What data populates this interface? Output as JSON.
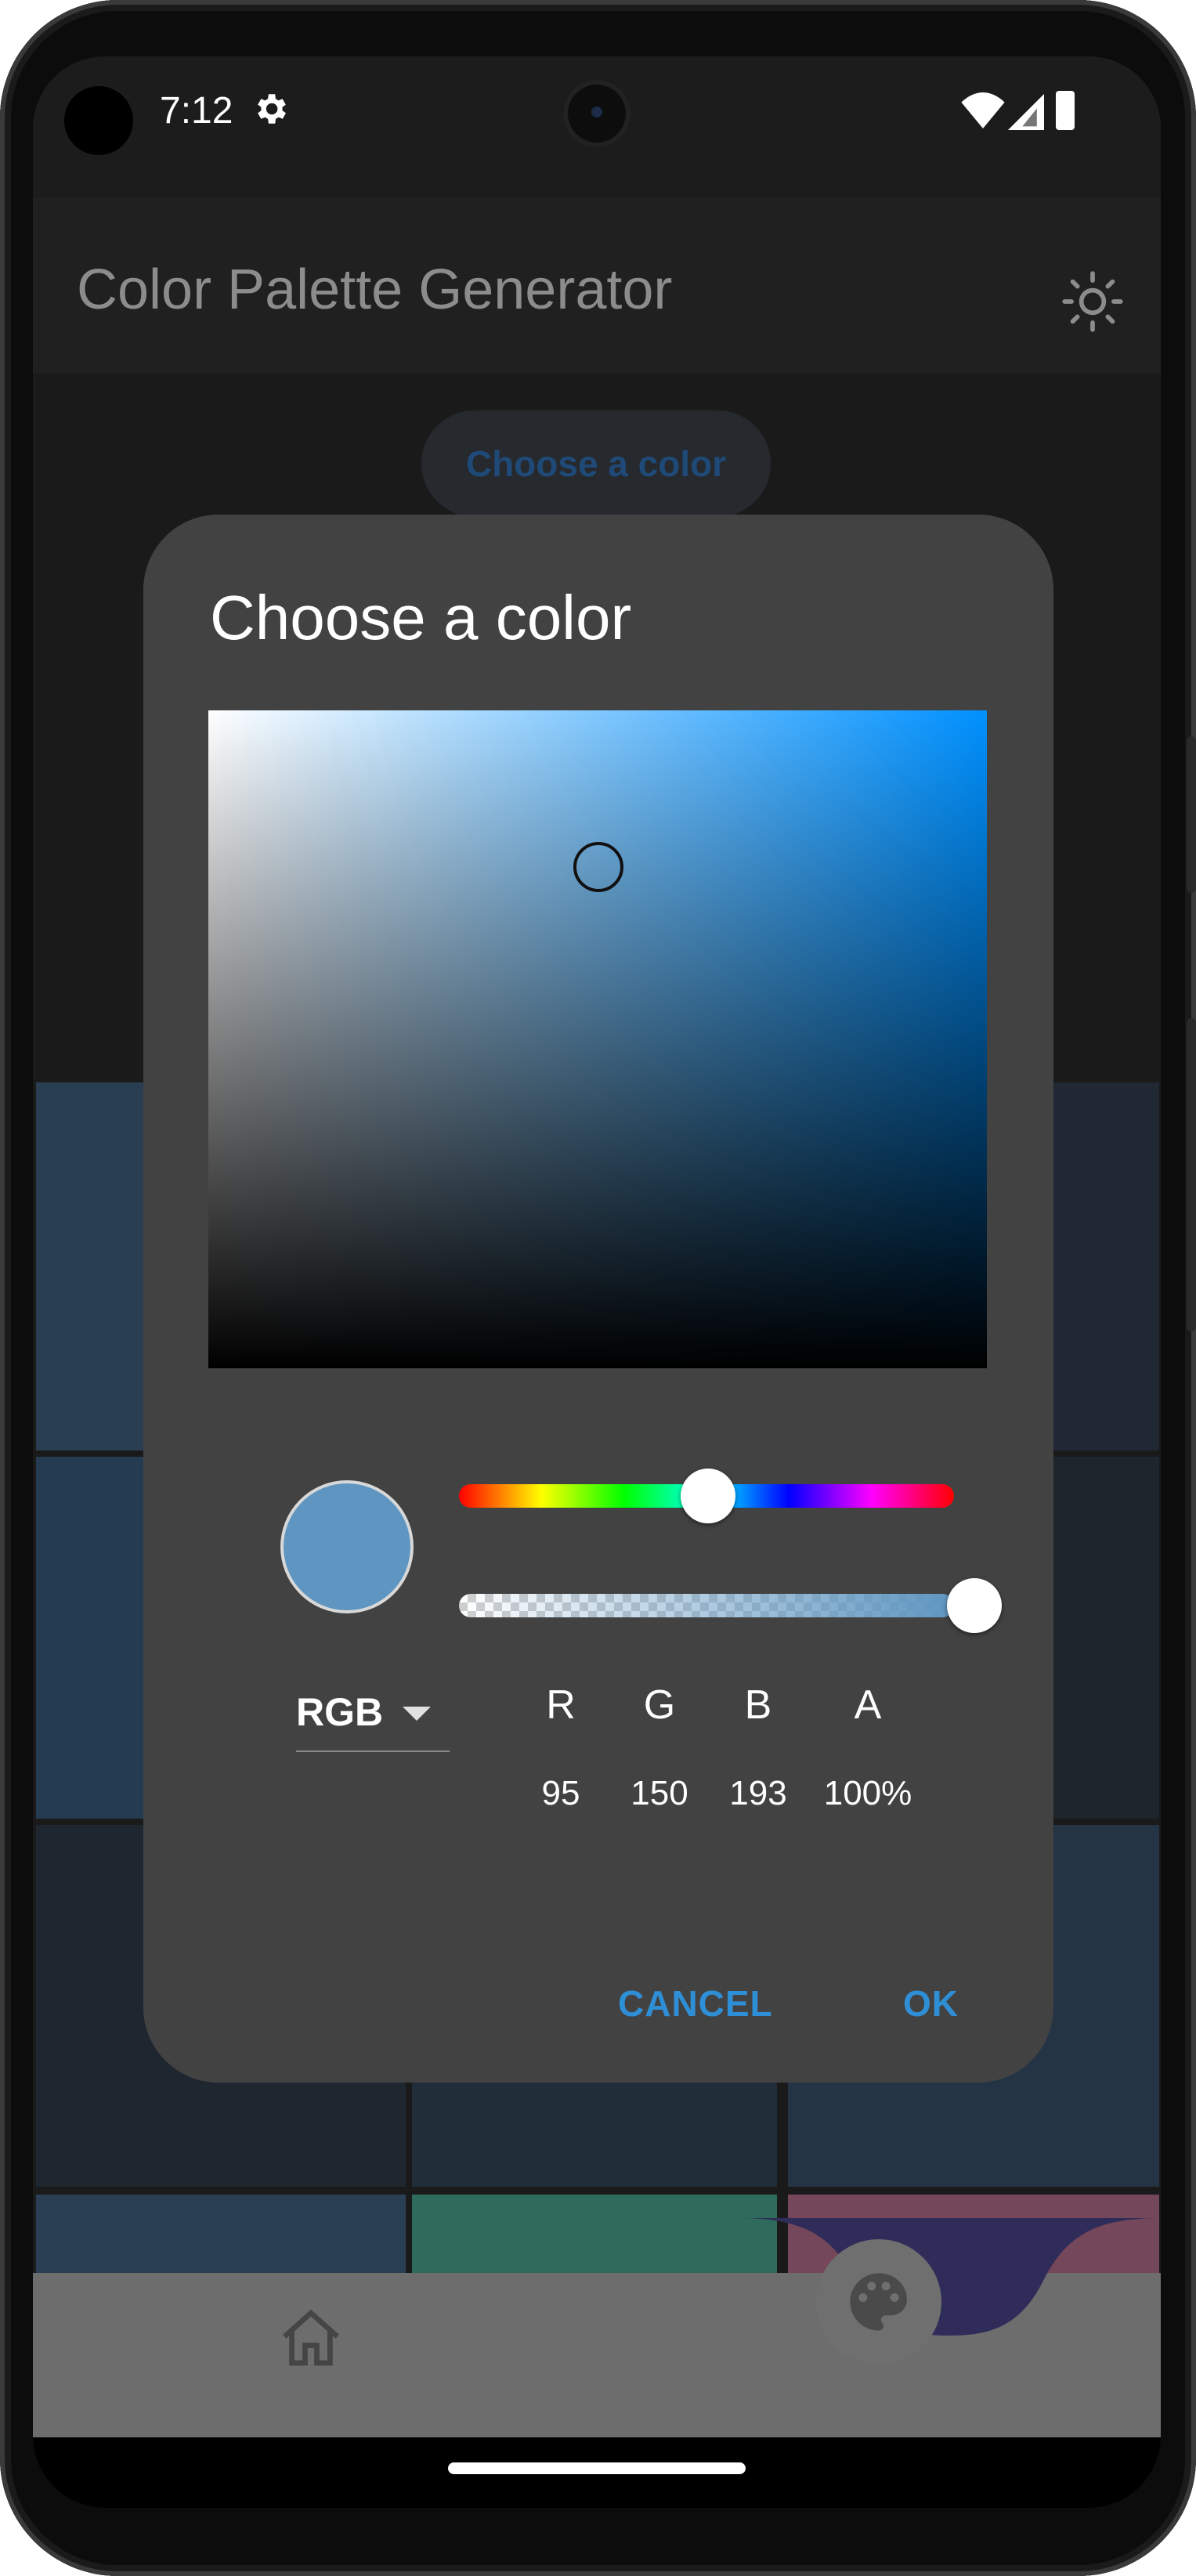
{
  "status_bar": {
    "time": "7:12",
    "icons": [
      "settings-gear-icon",
      "wifi-icon",
      "signal-icon",
      "battery-icon"
    ]
  },
  "app_bar": {
    "title": "Color Palette Generator",
    "theme_icon": "sun-icon"
  },
  "main": {
    "choose_button_label": "Choose a color"
  },
  "dialog": {
    "title": "Choose a color",
    "mode": "RGB",
    "channels": [
      {
        "label": "R",
        "value": "95"
      },
      {
        "label": "G",
        "value": "150"
      },
      {
        "label": "B",
        "value": "193"
      },
      {
        "label": "A",
        "value": "100%"
      }
    ],
    "cancel_label": "CANCEL",
    "ok_label": "OK",
    "selected_color": "#5f96c1",
    "hue_level": 0.57,
    "alpha_level": 1.0
  },
  "bottom_nav": {
    "home_icon": "home-icon",
    "fab_icon": "palette-icon"
  },
  "colors": {
    "accent": "#2f8fd6",
    "dialog_bg": "#424242",
    "app_bar_bg": "#202020"
  }
}
